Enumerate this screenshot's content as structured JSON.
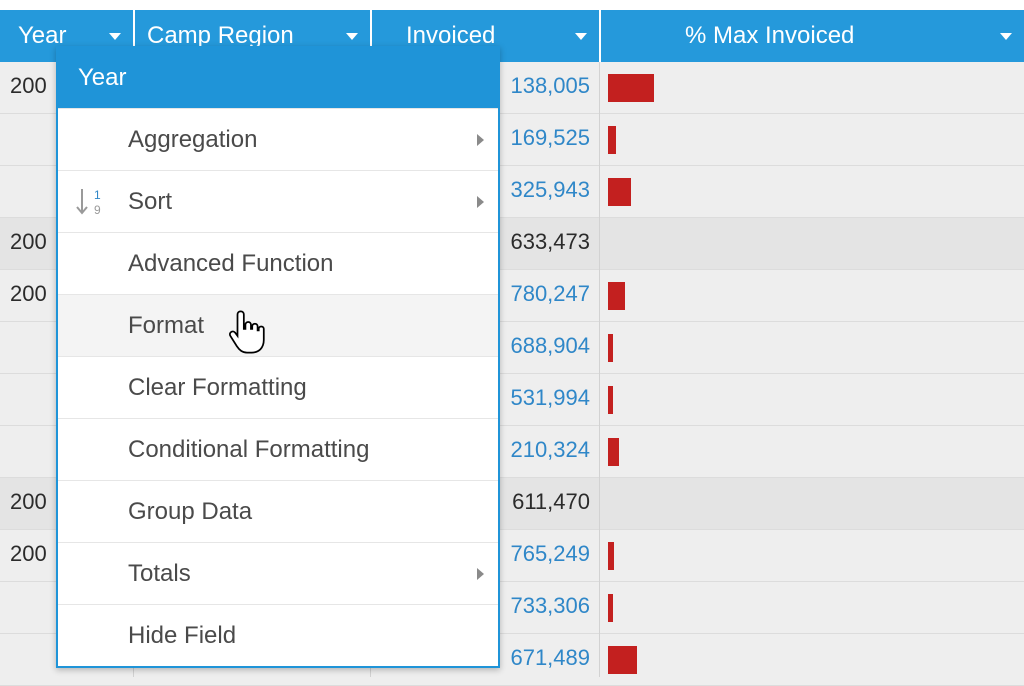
{
  "header": {
    "year": "Year",
    "camp_region": "Camp Region",
    "invoiced": "Invoiced",
    "max_invoiced": "% Max Invoiced"
  },
  "rows": [
    {
      "year": "200",
      "value": "138,005",
      "bar": 0.3,
      "kind": "sub"
    },
    {
      "year": "",
      "value": "169,525",
      "bar": 0.05,
      "kind": "sub"
    },
    {
      "year": "",
      "value": "325,943",
      "bar": 0.15,
      "kind": "sub"
    },
    {
      "year": "200",
      "value": "633,473",
      "bar": 0,
      "kind": "tot"
    },
    {
      "year": "200",
      "value": "780,247",
      "bar": 0.11,
      "kind": "sub"
    },
    {
      "year": "",
      "value": "688,904",
      "bar": 0.03,
      "kind": "sub"
    },
    {
      "year": "",
      "value": "531,994",
      "bar": 0.03,
      "kind": "sub"
    },
    {
      "year": "",
      "value": "210,324",
      "bar": 0.07,
      "kind": "sub"
    },
    {
      "year": "200",
      "value": "611,470",
      "bar": 0,
      "kind": "tot"
    },
    {
      "year": "200",
      "value": "765,249",
      "bar": 0.04,
      "kind": "sub"
    },
    {
      "year": "",
      "value": "733,306",
      "bar": 0.03,
      "kind": "sub"
    },
    {
      "year": "",
      "value": "671,489",
      "bar": 0.19,
      "kind": "sub"
    }
  ],
  "menu": {
    "title": "Year",
    "items": [
      {
        "label": "Aggregation",
        "submenu": true
      },
      {
        "label": "Sort",
        "submenu": true,
        "icon": "sort-icon"
      },
      {
        "label": "Advanced Function",
        "submenu": false
      },
      {
        "label": "Format",
        "submenu": false,
        "hover": true
      },
      {
        "label": "Clear Formatting",
        "submenu": false
      },
      {
        "label": "Conditional Formatting",
        "submenu": false
      },
      {
        "label": "Group Data",
        "submenu": false
      },
      {
        "label": "Totals",
        "submenu": true
      },
      {
        "label": "Hide Field",
        "submenu": false
      }
    ]
  },
  "colors": {
    "header": "#2599db",
    "menu_accent": "#1f94d8",
    "bar": "#c3201f",
    "link": "#2f87c8"
  }
}
